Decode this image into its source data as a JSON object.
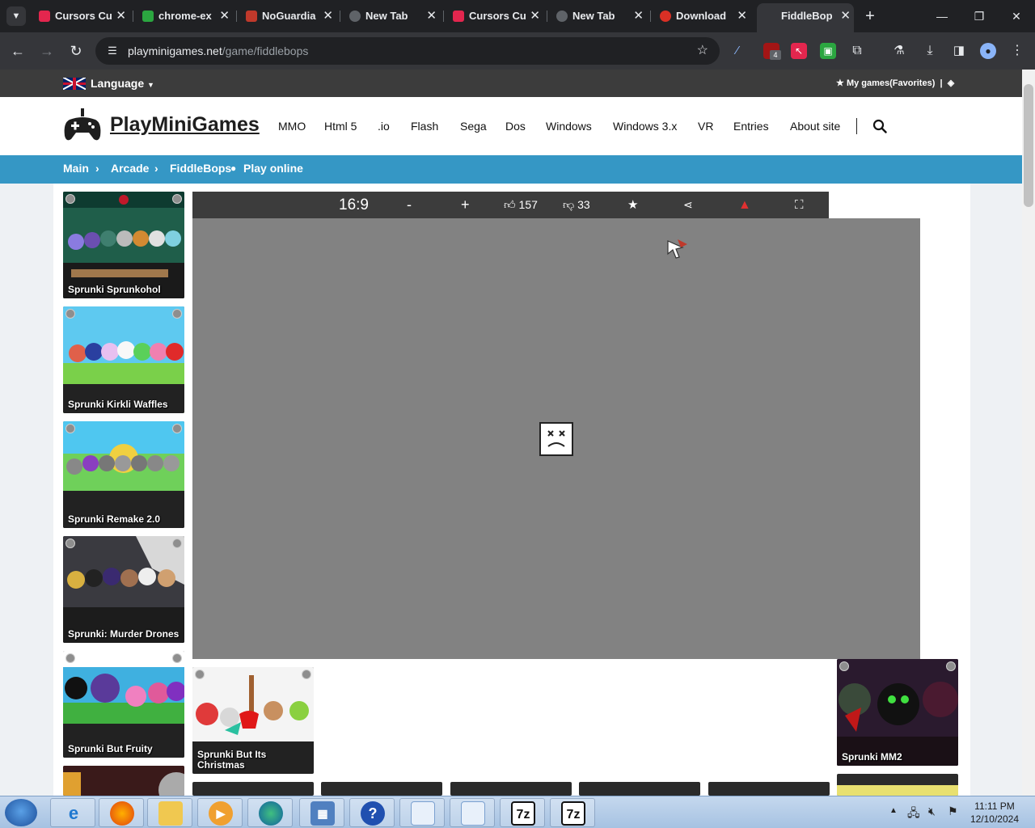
{
  "browser": {
    "tabs": [
      {
        "title": "Cursors Cu",
        "color": "#e3264e"
      },
      {
        "title": "chrome-ex",
        "color": "#2ba640"
      },
      {
        "title": "NoGuardia",
        "color": "#c0392b"
      },
      {
        "title": "New Tab",
        "color": "#9aa0a6"
      },
      {
        "title": "Cursors Cu",
        "color": "#e3264e"
      },
      {
        "title": "New Tab",
        "color": "#9aa0a6"
      },
      {
        "title": "Download",
        "color": "#d93025"
      },
      {
        "title": "FiddleBop",
        "color": "#ffffff"
      }
    ],
    "url_domain": "playminigames.net",
    "url_path": "/game/fiddlebops",
    "ext_badge": "4"
  },
  "site": {
    "language_label": "Language",
    "favorites_label": "My games(Favorites)",
    "logo_text": "PlayMiniGames",
    "menu": [
      "MMO",
      "Html 5",
      ".io",
      "Flash",
      "Sega",
      "Dos",
      "Windows",
      "Windows 3.x",
      "VR",
      "Entries",
      "About site"
    ],
    "breadcrumb": {
      "main": "Main",
      "arcade": "Arcade",
      "game": "FiddleBops",
      "play": "Play online"
    }
  },
  "game_bar": {
    "aspect": "16:9",
    "minus": "-",
    "plus": "+",
    "likes": "157",
    "dislikes": "33"
  },
  "sidebar_cards": [
    {
      "title": "Sprunki Sprunkohol"
    },
    {
      "title": "Sprunki Kirkli Waffles"
    },
    {
      "title": "Sprunki Remake 2.0"
    },
    {
      "title": "Sprunki: Murder Drones"
    },
    {
      "title": "Sprunki But Fruity"
    }
  ],
  "bottom_cards": [
    {
      "title": "Sprunki But Its Christmas"
    },
    {
      "title": "Sprunki MM2"
    }
  ],
  "taskbar": {
    "time": "11:11 PM",
    "date": "12/10/2024",
    "apps": [
      "ie",
      "firefox",
      "explorer",
      "media-player",
      "edge",
      "control-panel",
      "help",
      "notepad",
      "notepad",
      "7z",
      "7z"
    ]
  },
  "colors": {
    "breadcrumb_bg": "#3597c5",
    "site_topbar": "#3c3c3c",
    "game_area": "#828282"
  }
}
